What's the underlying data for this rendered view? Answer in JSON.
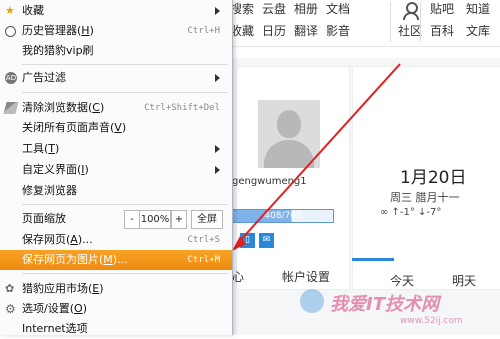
{
  "menu": {
    "favorites": "收藏",
    "history": "历史管理器",
    "history_key": "H",
    "history_shortcut": "Ctrl+H",
    "my_liebao": "我的猎豹vip刷",
    "adblock": "广告过滤",
    "clear_data": "清除浏览数据",
    "clear_data_key": "C",
    "clear_data_shortcut": "Ctrl+Shift+Del",
    "mute_all": "关闭所有页面声音",
    "mute_all_key": "V",
    "tools": "工具",
    "tools_key": "T",
    "custom_ui": "自定义界面",
    "custom_ui_key": "I",
    "repair": "修复浏览器",
    "page_zoom": "页面缩放",
    "zoom_minus": "-",
    "zoom_value": "100%",
    "zoom_plus": "+",
    "fullscreen": "全屏",
    "save_page": "保存网页",
    "save_page_key": "A",
    "save_page_shortcut": "Ctrl+S",
    "save_as_image": "保存网页为图片",
    "save_as_image_key": "M",
    "save_as_image_shortcut": "Ctrl+M",
    "app_market": "猎豹应用市场",
    "app_market_key": "E",
    "options": "选项/设置",
    "options_key": "O",
    "ie_options": "Internet选项"
  },
  "page": {
    "nav_row1": [
      "搜索",
      "云盘",
      "相册",
      "文档"
    ],
    "nav_row2": [
      "收藏",
      "日历",
      "翻译",
      "影音"
    ],
    "community": "社区",
    "tieba": "贴吧",
    "zhidao": "知道",
    "baike": "百科",
    "wenku": "文库",
    "username": "gengwumeng1",
    "progress_text": "408/700",
    "progress_fraction": 0.583,
    "center_label": "心",
    "account_settings": "帐户设置",
    "date": "1月20日",
    "weekday": "周三  腊月十一",
    "weather": "∞ ↑-1°  ↓-7°",
    "today": "今天",
    "tomorrow": "明天"
  },
  "watermark": {
    "main": "我爱IT技术网",
    "sub": "www.52ij.com"
  },
  "colors": {
    "highlight": "#f09214",
    "arrow": "#e02020",
    "progress": "#7fb2e8",
    "accent_blue": "#2b88d8"
  }
}
